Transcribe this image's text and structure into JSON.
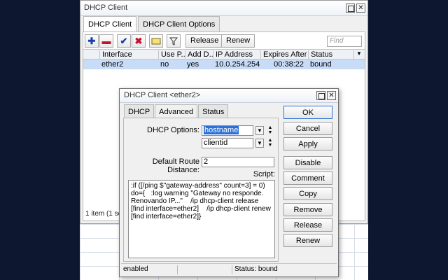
{
  "main": {
    "title": "DHCP Client",
    "tabs": [
      "DHCP Client",
      "DHCP Client Options"
    ],
    "toolbar": {
      "release_label": "Release",
      "renew_label": "Renew",
      "find_placeholder": "Find"
    },
    "table": {
      "columns": [
        "Interface",
        "Use P...",
        "Add D...",
        "IP Address",
        "Expires After",
        "Status"
      ],
      "rows": [
        {
          "interface": "ether2",
          "use_peer": "no",
          "add_default": "yes",
          "ip": "10.0.254.254...",
          "expires": "00:38:22",
          "status": "bound"
        }
      ]
    },
    "status_text": "1 item (1 sele"
  },
  "dialog": {
    "title": "DHCP Client <ether2>",
    "tabs": [
      "DHCP",
      "Advanced",
      "Status"
    ],
    "dhcp_options_label": "DHCP Options:",
    "option1": "hostname",
    "option2": "clientid",
    "route_distance_label": "Default Route Distance:",
    "route_distance_value": "2",
    "script_label": "Script:",
    "script": ":if ([/ping $\"gateway-address\" count=3] = 0)\ndo={   :log warning \"Gateway no responde.\nRenovando IP...\"    /ip dhcp-client release\n[find interface=ether2]    /ip dhcp-client renew\n[find interface=ether2]}",
    "buttons": [
      "OK",
      "Cancel",
      "Apply",
      "Disable",
      "Comment",
      "Copy",
      "Remove",
      "Release",
      "Renew"
    ],
    "status_left": "enabled",
    "status_right": "Status: bound"
  }
}
